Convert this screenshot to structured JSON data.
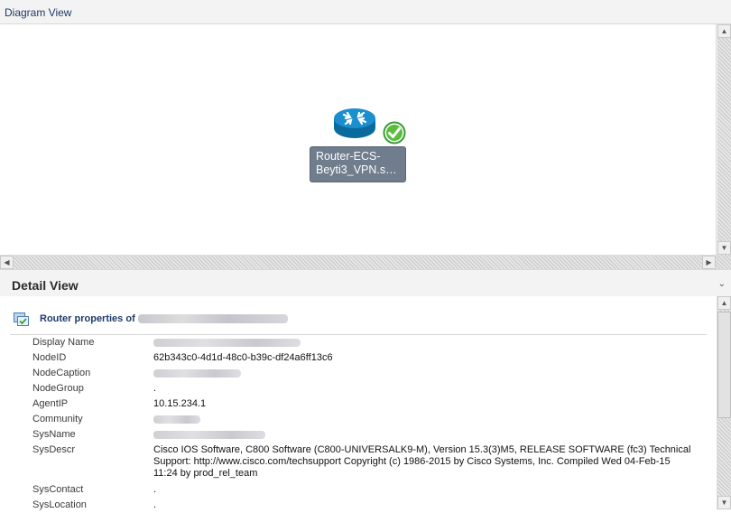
{
  "diagram_view": {
    "title": "Diagram View",
    "node": {
      "label_line1": "Router-ECS-",
      "label_line2": "Beyti3_VPN.s…",
      "icon": "router-icon",
      "status_icon": "check-circle-icon",
      "status_color": "#4caf50"
    }
  },
  "detail_view": {
    "title": "Detail View",
    "collapse_icon": "chevron-down-icon",
    "properties_title": "Router properties of",
    "properties_icon": "router-properties-icon",
    "rows": [
      {
        "label": "Display Name",
        "value": "",
        "redacted": true
      },
      {
        "label": "NodeID",
        "value": "62b343c0-4d1d-48c0-b39c-df24a6ff13c6",
        "redacted": false
      },
      {
        "label": "NodeCaption",
        "value": "",
        "redacted": true
      },
      {
        "label": "NodeGroup",
        "value": ".",
        "redacted": false
      },
      {
        "label": "AgentIP",
        "value": "10.15.234.1",
        "redacted": false
      },
      {
        "label": "Community",
        "value": "",
        "redacted": true
      },
      {
        "label": "SysName",
        "value": "",
        "redacted": true
      },
      {
        "label": "SysDescr",
        "value": "Cisco IOS Software, C800 Software (C800-UNIVERSALK9-M), Version 15.3(3)M5, RELEASE SOFTWARE (fc3) Technical Support: http://www.cisco.com/techsupport Copyright (c) 1986-2015 by Cisco Systems, Inc. Compiled Wed 04-Feb-15 11:24 by prod_rel_team",
        "redacted": false
      },
      {
        "label": "SysContact",
        "value": ".",
        "redacted": false
      },
      {
        "label": "SysLocation",
        "value": ".",
        "redacted": false
      }
    ]
  }
}
